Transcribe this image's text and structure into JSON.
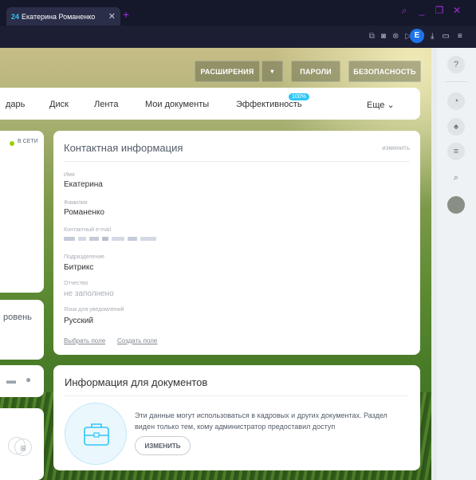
{
  "browser": {
    "tab_title": "Екатерина Романенко",
    "tab_favicon": "24",
    "avatar_letter": "E",
    "accent": "#9b2fd8"
  },
  "top_buttons": {
    "extensions": "РАСШИРЕНИЯ",
    "passwords": "ПАРОЛИ",
    "security": "БЕЗОПАСНОСТЬ"
  },
  "nav": {
    "items": [
      "дарь",
      "Диск",
      "Лента",
      "Мои документы",
      "Эффективность",
      "Еще"
    ],
    "efficiency_badge": "100%"
  },
  "left": {
    "online": "В СЕТИ",
    "level": "ровень"
  },
  "contact": {
    "title": "Контактная информация",
    "edit": "изменить",
    "fields": [
      {
        "label": "Имя",
        "value": "Екатерина"
      },
      {
        "label": "Фамилия",
        "value": "Романенко"
      },
      {
        "label": "Контактный e-mail",
        "value": ""
      },
      {
        "label": "Подразделение",
        "value": "Битрикс"
      },
      {
        "label": "Отчество",
        "value": "не заполнено"
      },
      {
        "label": "Язык для уведомлений",
        "value": "Русский"
      }
    ],
    "link_choose": "Выбрать поле",
    "link_create": "Создать поле"
  },
  "docs": {
    "title": "Информация для документов",
    "text": "Эти данные могут использоваться в кадровых и других документах. Раздел виден только тем, кому администратор предоставил доступ",
    "button": "ИЗМЕНИТЬ"
  }
}
